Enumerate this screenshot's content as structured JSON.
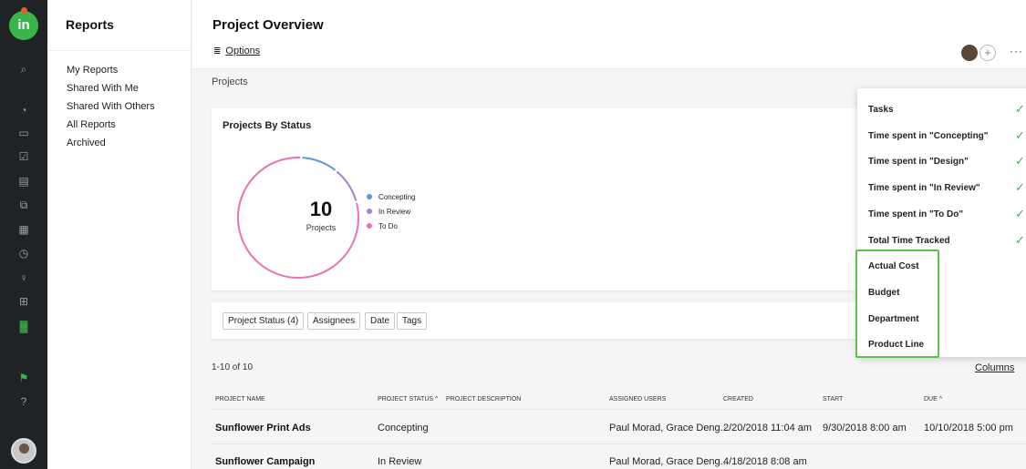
{
  "rail": {
    "logo_text": "in",
    "icons": [
      "search-icon",
      "dashboard-icon",
      "folder-icon",
      "tasks-icon",
      "inbox-icon",
      "proofing-icon",
      "calendar-icon",
      "time-icon",
      "users-icon",
      "portfolio-icon",
      "reports-icon",
      "alert-icon",
      "help-icon"
    ]
  },
  "sidebar": {
    "title": "Reports",
    "items": [
      "My Reports",
      "Shared With Me",
      "Shared With Others",
      "All Reports",
      "Archived"
    ]
  },
  "header": {
    "title": "Project Overview",
    "options_label": "Options",
    "more_label": "···",
    "add_label": "+"
  },
  "breadcrumb": "Projects",
  "chart_card": {
    "title": "Projects By Status",
    "center_value": "10",
    "center_label": "Projects"
  },
  "chart_data": {
    "type": "pie",
    "title": "Projects By Status",
    "total": 10,
    "series": [
      {
        "name": "Concepting",
        "value": 1,
        "color": "#5b9bd5"
      },
      {
        "name": "In Review",
        "value": 1,
        "color": "#a57fd1"
      },
      {
        "name": "To Do",
        "value": 8,
        "color": "#e873b4"
      }
    ],
    "legend": "right"
  },
  "filters": [
    "Project Status (4)",
    "Assignees",
    "Date",
    "Tags"
  ],
  "results": {
    "count": "1-10 of 10",
    "columns_label": "Columns"
  },
  "table": {
    "headers": [
      "Project Name",
      "Project Status ^",
      "Project Description",
      "Assigned Users",
      "Created",
      "Start",
      "Due ^"
    ],
    "rows": [
      [
        "Sunflower Print Ads",
        "Concepting",
        "",
        "Paul Morad, Grace Deng...",
        "2/20/2018 11:04 am",
        "9/30/2018 8:00 am",
        "10/10/2018 5:00 pm"
      ],
      [
        "Sunflower Campaign",
        "In Review",
        "",
        "Paul Morad, Grace Deng...",
        "4/18/2018 8:08 am",
        "",
        ""
      ]
    ]
  },
  "column_menu": {
    "items": [
      {
        "label": "Tasks",
        "checked": true
      },
      {
        "label": "Time spent in \"Concepting\"",
        "checked": true
      },
      {
        "label": "Time spent in \"Design\"",
        "checked": true
      },
      {
        "label": "Time spent in \"In Review\"",
        "checked": true
      },
      {
        "label": "Time spent in \"To Do\"",
        "checked": true
      },
      {
        "label": "Total Time Tracked",
        "checked": true
      },
      {
        "label": "Actual Cost",
        "checked": false
      },
      {
        "label": "Budget",
        "checked": false
      },
      {
        "label": "Department",
        "checked": false
      },
      {
        "label": "Product Line",
        "checked": false
      }
    ]
  },
  "colors": {
    "accent": "#3bb54a",
    "rail_bg": "#1f2326",
    "highlight": "#5cc24a"
  }
}
